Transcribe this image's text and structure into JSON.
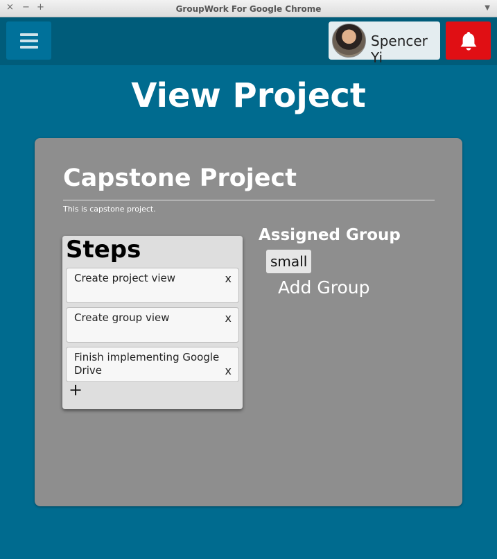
{
  "window": {
    "title": "GroupWork For Google Chrome",
    "controls": {
      "close": "×",
      "minimize": "−",
      "maximize": "+"
    }
  },
  "header": {
    "user": {
      "name": "Spencer Yi"
    },
    "icons": {
      "menu": "hamburger-menu-icon",
      "notifications": "bell-icon"
    },
    "colors": {
      "appbar": "#005c7a",
      "background": "#006b8f",
      "bell_button": "#e00f14"
    }
  },
  "page": {
    "title": "View Project"
  },
  "project": {
    "title": "Capstone Project",
    "description": "This is capstone project."
  },
  "steps": {
    "title": "Steps",
    "items": [
      {
        "text": "Create project view",
        "remove": "x"
      },
      {
        "text": "Create group view",
        "remove": "x"
      },
      {
        "text": "Finish implementing Google Drive",
        "remove": "x"
      }
    ],
    "add_label": "+"
  },
  "assigned": {
    "title": "Assigned Group",
    "groups": [
      "small"
    ],
    "add_label": "Add Group"
  }
}
